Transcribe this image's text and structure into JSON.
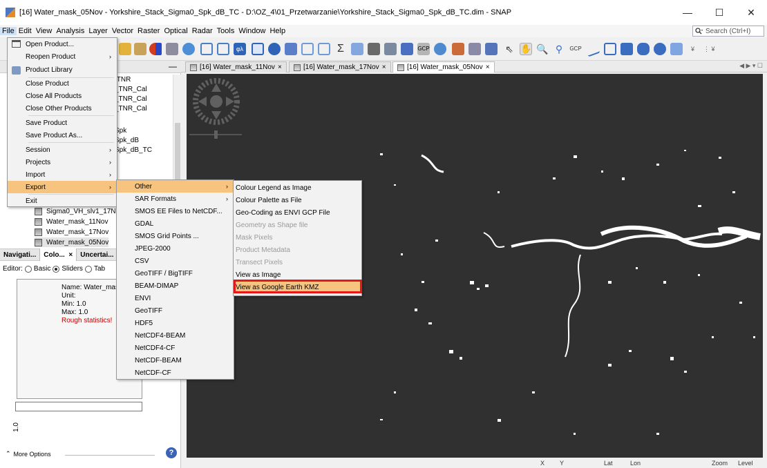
{
  "window": {
    "title": "[16] Water_mask_05Nov - Yorkshire_Stack_Sigma0_Spk_dB_TC - D:\\OZ_4\\01_Przetwarzanie\\Yorkshire_Stack_Sigma0_Spk_dB_TC.dim - SNAP",
    "minimize": "—",
    "maximize": "☐",
    "close": "✕"
  },
  "menubar": {
    "items": [
      "File",
      "Edit",
      "View",
      "Analysis",
      "Layer",
      "Vector",
      "Raster",
      "Optical",
      "Radar",
      "Tools",
      "Window",
      "Help"
    ],
    "search_placeholder": "Search (Ctrl+I)"
  },
  "file_menu": {
    "items": [
      {
        "label": "Open Product...",
        "has_submenu": false
      },
      {
        "label": "Reopen Product",
        "has_submenu": true
      },
      {
        "label": "Product Library",
        "has_submenu": false
      },
      {
        "label": "Close Product",
        "has_submenu": false
      },
      {
        "label": "Close All Products",
        "has_submenu": false
      },
      {
        "label": "Close Other Products",
        "has_submenu": false
      },
      {
        "label": "Save Product",
        "has_submenu": false
      },
      {
        "label": "Save Product As...",
        "has_submenu": false
      },
      {
        "label": "Session",
        "has_submenu": true
      },
      {
        "label": "Projects",
        "has_submenu": true
      },
      {
        "label": "Import",
        "has_submenu": true
      },
      {
        "label": "Export",
        "has_submenu": true,
        "highlighted": true
      },
      {
        "label": "Exit",
        "has_submenu": false
      }
    ]
  },
  "export_menu": {
    "items": [
      {
        "label": "Other",
        "has_submenu": true,
        "highlighted": true
      },
      {
        "label": "SAR Formats",
        "has_submenu": true
      },
      {
        "label": "SMOS EE Files to NetCDF..."
      },
      {
        "label": "GDAL"
      },
      {
        "label": "SMOS Grid Points ..."
      },
      {
        "label": "JPEG-2000"
      },
      {
        "label": "CSV"
      },
      {
        "label": "GeoTIFF / BigTIFF"
      },
      {
        "label": "BEAM-DIMAP"
      },
      {
        "label": "ENVI"
      },
      {
        "label": "GeoTIFF"
      },
      {
        "label": "HDF5"
      },
      {
        "label": "NetCDF4-BEAM"
      },
      {
        "label": "NetCDF4-CF"
      },
      {
        "label": "NetCDF-BEAM"
      },
      {
        "label": "NetCDF-CF"
      }
    ]
  },
  "other_menu": {
    "items": [
      {
        "label": "Colour Legend as Image",
        "enabled": true
      },
      {
        "label": "Colour Palette as File",
        "enabled": true
      },
      {
        "label": "Geo-Coding as ENVI GCP File",
        "enabled": true
      },
      {
        "label": "Geometry as Shape file",
        "enabled": false
      },
      {
        "label": "Mask Pixels",
        "enabled": false
      },
      {
        "label": "Product Metadata",
        "enabled": false
      },
      {
        "label": "Transect Pixels",
        "enabled": false
      },
      {
        "label": "View as Image",
        "enabled": true
      },
      {
        "label": "View as Google Earth KMZ",
        "enabled": true,
        "highlighted": true
      }
    ]
  },
  "product_tree": {
    "partial_items": [
      ".TNR",
      "_TNR_Cal",
      "_TNR_Cal",
      "_TNR_Cal",
      "Spk",
      "Spk_dB",
      "Spk_dB_TC"
    ],
    "bands": [
      "Sigma0_VH_slv1_17N",
      "Water_mask_11Nov",
      "Water_mask_17Nov",
      "Water_mask_05Nov"
    ]
  },
  "bottom_panel": {
    "tabs": [
      "Navigati...",
      "Colo...",
      "Uncertai..."
    ],
    "tab_close": "×",
    "editor_label": "Editor:",
    "editor_options": [
      "Basic",
      "Sliders",
      "Tab"
    ],
    "info": {
      "name": "Name: Water_mas",
      "unit": "Unit:",
      "min": "Min: 1.0",
      "max": "Max: 1.0",
      "warning": "Rough statistics!"
    },
    "slider_value": "1.0",
    "more_options": "More Options",
    "help": "?"
  },
  "doc_tabs": [
    {
      "label": "[16] Water_mask_11Nov",
      "active": false
    },
    {
      "label": "[16] Water_mask_17Nov",
      "active": false
    },
    {
      "label": "[16] Water_mask_05Nov",
      "active": true
    }
  ],
  "statusbar": {
    "x": "X",
    "y": "Y",
    "lat": "Lat",
    "lon": "Lon",
    "zoom": "Zoom",
    "level": "Level"
  },
  "colors": {
    "highlight": "#f6c47f",
    "callout": "#e31818",
    "image_bg": "#303030",
    "warning_text": "#c00000"
  }
}
